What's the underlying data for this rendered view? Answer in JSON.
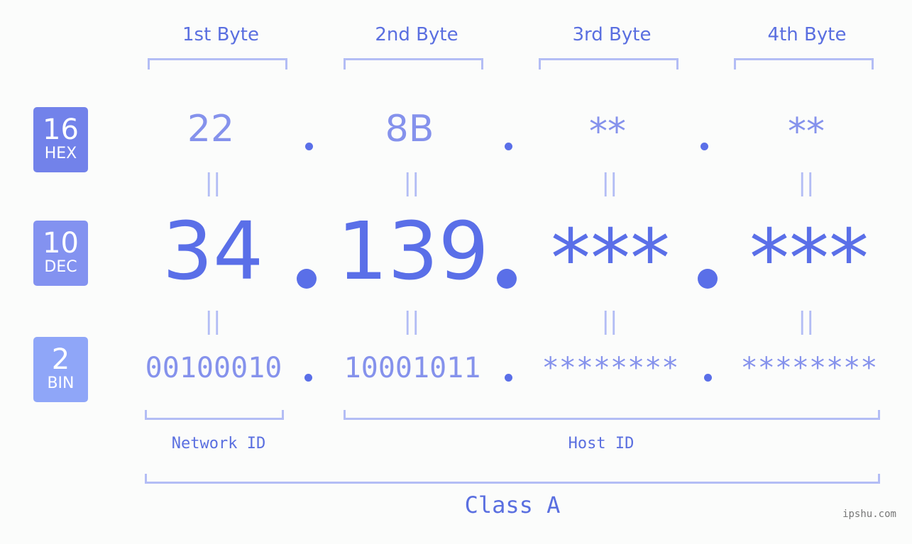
{
  "headers": [
    "1st Byte",
    "2nd Byte",
    "3rd Byte",
    "4th Byte"
  ],
  "badges": [
    {
      "num": "16",
      "label": "HEX",
      "color": "#7282ea"
    },
    {
      "num": "10",
      "label": "DEC",
      "color": "#8392f0"
    },
    {
      "num": "2",
      "label": "BIN",
      "color": "#8fa6f8"
    }
  ],
  "hex": [
    "22",
    "8B",
    "**",
    "**"
  ],
  "dec": [
    "34",
    "139",
    "***",
    "***"
  ],
  "bin": [
    "00100010",
    "10001011",
    "********",
    "********"
  ],
  "equals": "||",
  "network_label": "Network ID",
  "host_label": "Host ID",
  "class_label": "Class A",
  "watermark": "ipshu.com",
  "colors": {
    "accent": "#5a6fe8",
    "light": "#8592ec",
    "bracket": "#b3bdf5",
    "background": "#fbfcfb"
  }
}
